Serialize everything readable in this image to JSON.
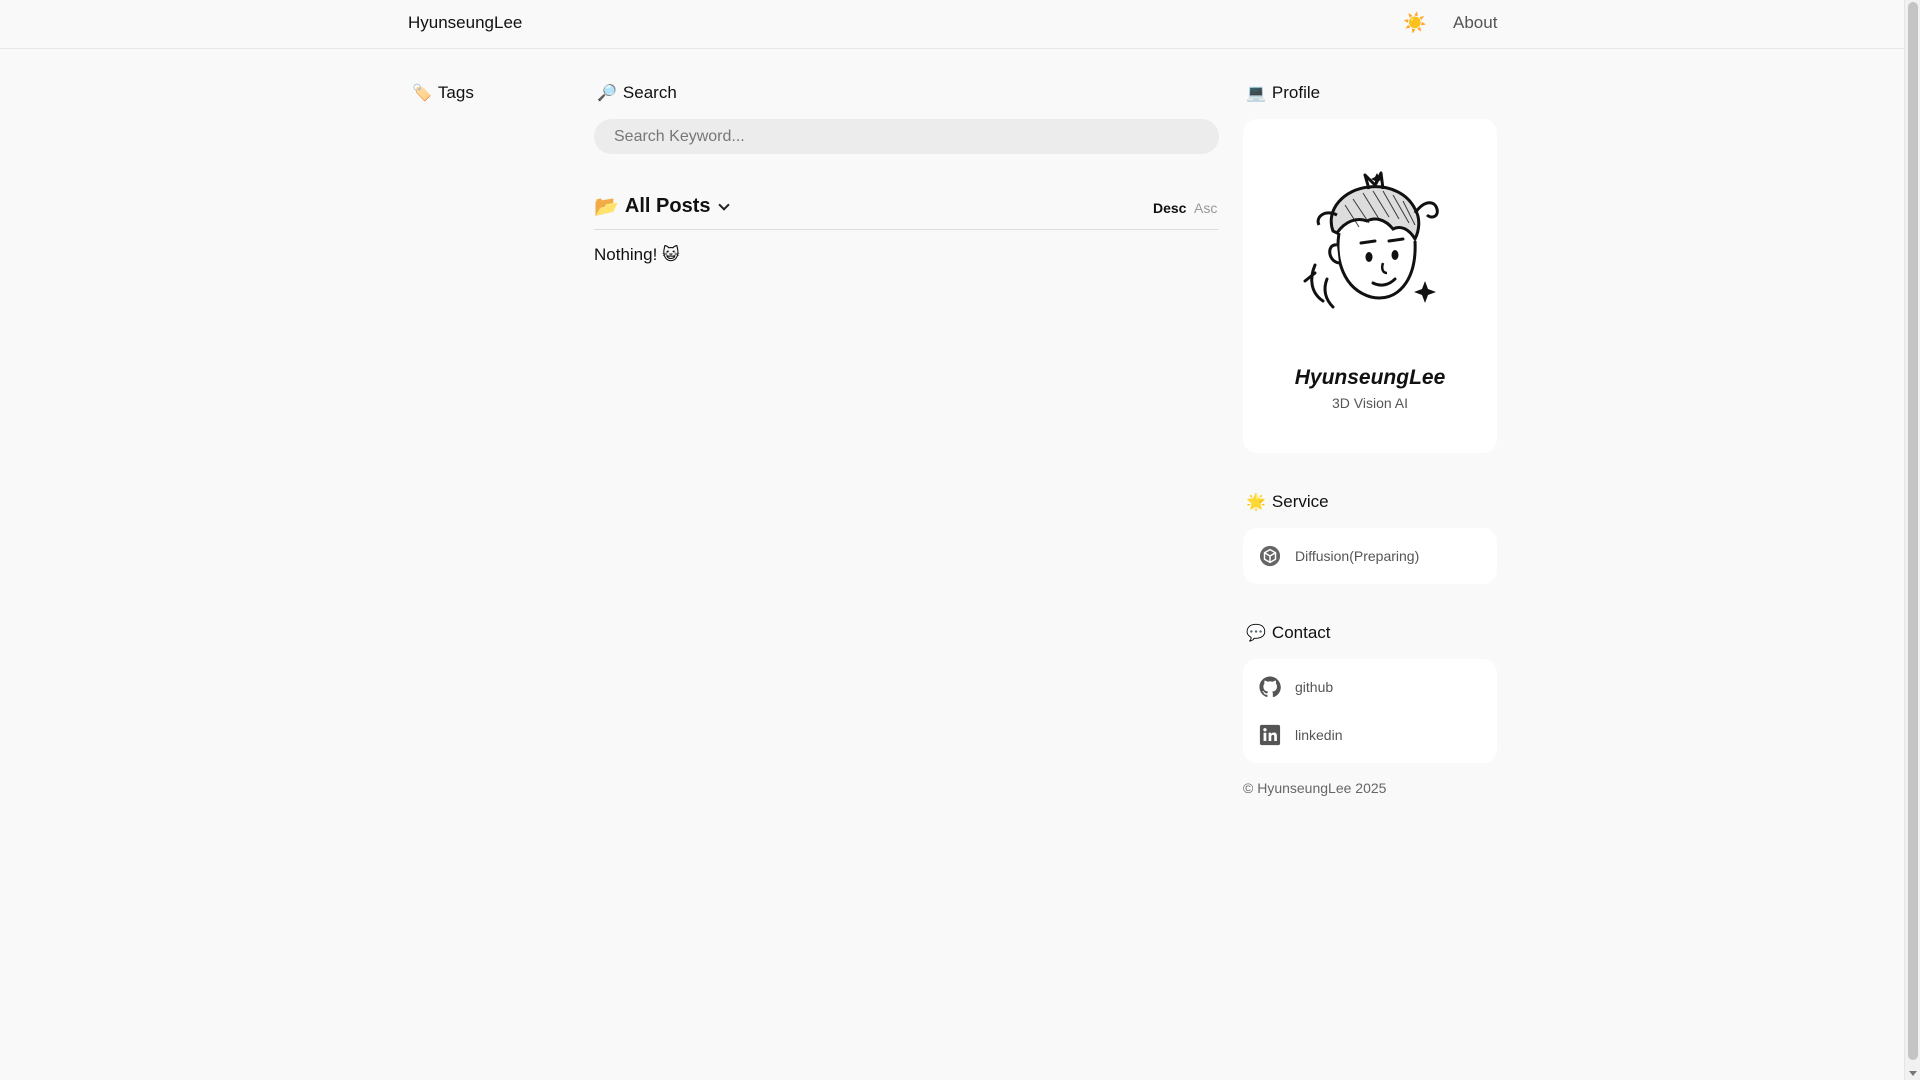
{
  "header": {
    "brand": "HyunseungLee",
    "theme_icon": "sun-icon",
    "theme_glyph": "☀️",
    "about_label": "About"
  },
  "tags": {
    "emoji": "🏷️",
    "title": "Tags"
  },
  "search": {
    "emoji": "🔎",
    "title": "Search",
    "placeholder": "Search Keyword..."
  },
  "posts": {
    "emoji": "📂",
    "title": "All Posts",
    "sort_desc": "Desc",
    "sort_asc": "Asc",
    "empty_text": "Nothing! 😺"
  },
  "profile": {
    "emoji": "💻",
    "title": "Profile",
    "name": "HyunseungLee",
    "role": "3D Vision AI"
  },
  "service": {
    "emoji": "🌟",
    "title": "Service",
    "items": [
      {
        "label": "Diffusion(Preparing)",
        "icon": "cube-icon"
      }
    ]
  },
  "contact": {
    "emoji": "💬",
    "title": "Contact",
    "items": [
      {
        "label": "github",
        "icon": "github-icon"
      },
      {
        "label": "linkedin",
        "icon": "linkedin-icon"
      }
    ]
  },
  "footer": {
    "copyright": "© HyunseungLee 2025"
  },
  "colors": {
    "background": "#f9f9f9",
    "card": "#ffffff",
    "accent_sun": "#f5b400",
    "muted_text": "#555555"
  }
}
